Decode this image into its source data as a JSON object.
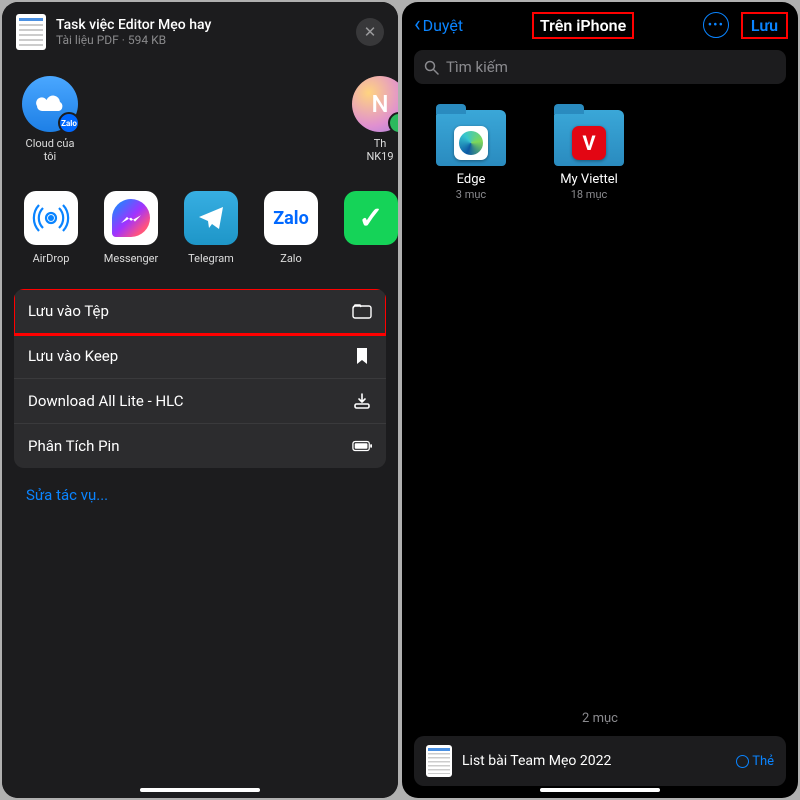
{
  "left": {
    "doc_title": "Task việc Editor Mẹo hay",
    "doc_subtitle": "Tài liệu PDF · 594 KB",
    "targets": [
      {
        "label": "Cloud của tôi",
        "badge": "Zalo"
      },
      {
        "label_line1": "Th",
        "label_line2": "NK19"
      }
    ],
    "apps": {
      "airdrop": "AirDrop",
      "messenger": "Messenger",
      "telegram": "Telegram",
      "zalo": "Zalo",
      "zalo_text": "Zalo"
    },
    "actions": {
      "save_files": "Lưu vào Tệp",
      "save_keep": "Lưu vào Keep",
      "download_all": "Download All Lite - HLC",
      "battery": "Phân Tích Pin"
    },
    "edit_actions": "Sửa tác vụ..."
  },
  "right": {
    "back": "Duyệt",
    "title": "Trên iPhone",
    "save": "Lưu",
    "search_placeholder": "Tìm kiếm",
    "folders": {
      "edge": {
        "name": "Edge",
        "count": "3 mục"
      },
      "viettel": {
        "name": "My Viettel",
        "count": "18 mục"
      }
    },
    "total_count": "2 mục",
    "bottom_file": "List bài Team Mẹo 2022",
    "tag_label": "Thẻ"
  }
}
